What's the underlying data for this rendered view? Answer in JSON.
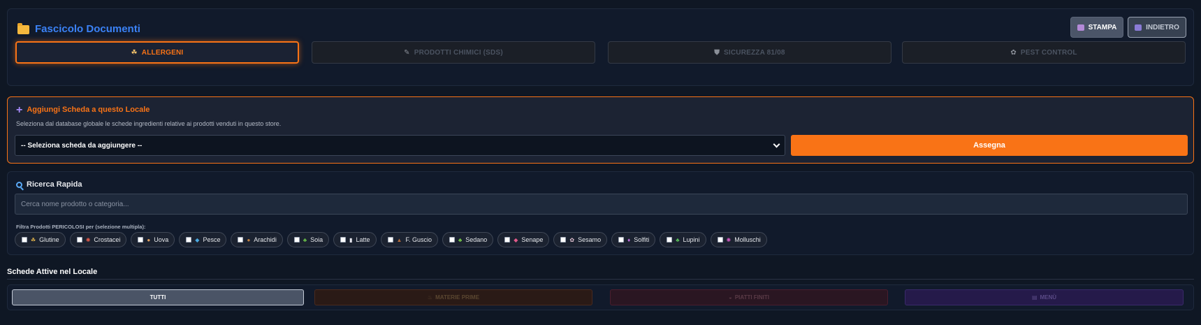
{
  "header": {
    "title": "Fascicolo Documenti",
    "print_label": "STAMPA",
    "back_label": "INDIETRO",
    "tabs": [
      {
        "label": "ALLERGENI",
        "glyph": "☘"
      },
      {
        "label": "PRODOTTI CHIMICI (SDS)",
        "glyph": "✎"
      },
      {
        "label": "SICUREZZA 81/08",
        "glyph": "⛊"
      },
      {
        "label": "PEST CONTROL",
        "glyph": "✿"
      }
    ]
  },
  "assign": {
    "title": "Aggiungi Scheda a questo Locale",
    "description": "Seleziona dal database globale le schede ingredienti relative ai prodotti venduti in questo store.",
    "select_value": "-- Seleziona scheda da aggiungere --",
    "button_label": "Assegna"
  },
  "search": {
    "title": "Ricerca Rapida",
    "placeholder": "Cerca nome prodotto o categoria...",
    "filter_label": "Filtra Prodotti PERICOLOSI per (selezione multipla):",
    "allergens": [
      {
        "label": "Glutine",
        "glyph": "☘"
      },
      {
        "label": "Crostacei",
        "glyph": "✺"
      },
      {
        "label": "Uova",
        "glyph": "●"
      },
      {
        "label": "Pesce",
        "glyph": "◆"
      },
      {
        "label": "Arachidi",
        "glyph": "●"
      },
      {
        "label": "Soia",
        "glyph": "♣"
      },
      {
        "label": "Latte",
        "glyph": "▮"
      },
      {
        "label": "F. Guscio",
        "glyph": "▲"
      },
      {
        "label": "Sedano",
        "glyph": "♣"
      },
      {
        "label": "Senape",
        "glyph": "◆"
      },
      {
        "label": "Sesamo",
        "glyph": "✿"
      },
      {
        "label": "Solfiti",
        "glyph": "♦"
      },
      {
        "label": "Lupini",
        "glyph": "♣"
      },
      {
        "label": "Molluschi",
        "glyph": "✺"
      }
    ]
  },
  "active": {
    "title": "Schede Attive nel Locale",
    "filters": {
      "all": "TUTTI",
      "raw": "MATERIE PRIME",
      "dish": "PIATTI FINITI",
      "menu": "MENÙ"
    }
  },
  "colors": {
    "accent": "#f97316",
    "title_blue": "#3b82f6",
    "background": "#0f1724"
  }
}
